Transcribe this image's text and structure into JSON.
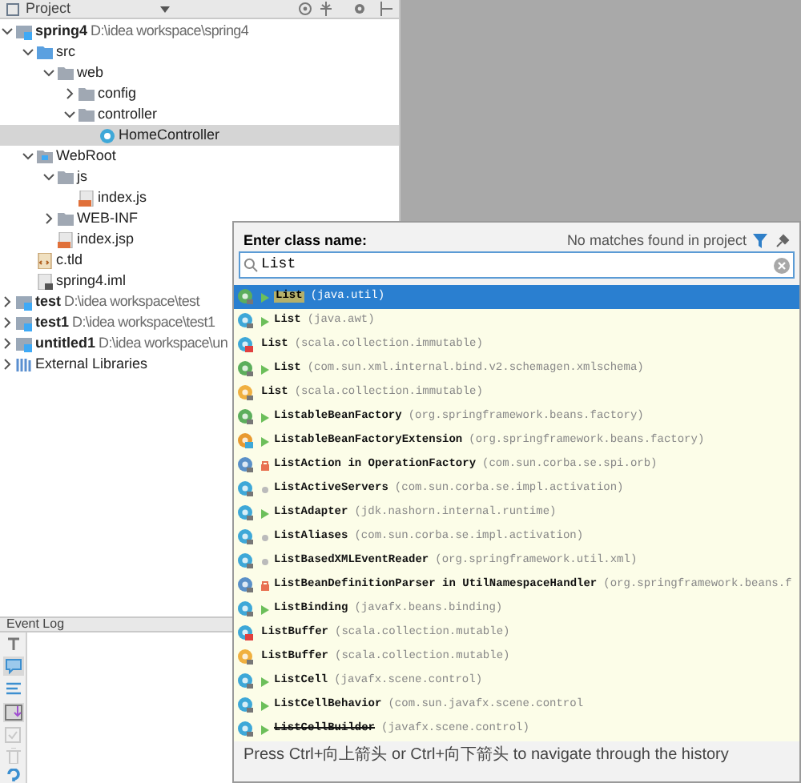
{
  "project_panel": {
    "title": "Project",
    "tree": [
      {
        "label": "spring4",
        "path": "D:\\idea workspace\\spring4",
        "kind": "module",
        "bold": true,
        "expanded": true,
        "selected": false,
        "children": [
          {
            "label": "src",
            "kind": "src",
            "expanded": true,
            "selected": false,
            "children": [
              {
                "label": "web",
                "kind": "folder",
                "expanded": true,
                "selected": false,
                "children": [
                  {
                    "label": "config",
                    "kind": "folder",
                    "expanded": false,
                    "selected": false
                  },
                  {
                    "label": "controller",
                    "kind": "folder",
                    "expanded": true,
                    "selected": false,
                    "children": [
                      {
                        "label": "HomeController",
                        "kind": "java",
                        "selected": true
                      }
                    ]
                  }
                ]
              }
            ]
          },
          {
            "label": "WebRoot",
            "kind": "webroot",
            "expanded": true,
            "selected": false,
            "children": [
              {
                "label": "js",
                "kind": "folder",
                "expanded": true,
                "selected": false,
                "children": [
                  {
                    "label": "index.js",
                    "kind": "js",
                    "selected": false
                  }
                ]
              },
              {
                "label": "WEB-INF",
                "kind": "folder",
                "expanded": false,
                "selected": false
              },
              {
                "label": "index.jsp",
                "kind": "jsp",
                "selected": false
              }
            ]
          },
          {
            "label": "c.tld",
            "kind": "tld",
            "selected": false
          },
          {
            "label": "spring4.iml",
            "kind": "iml",
            "selected": false
          }
        ]
      },
      {
        "label": "test",
        "path": "D:\\idea workspace\\test",
        "kind": "module",
        "bold": true,
        "expanded": false,
        "selected": false
      },
      {
        "label": "test1",
        "path": "D:\\idea workspace\\test1",
        "kind": "module",
        "bold": true,
        "expanded": false,
        "selected": false
      },
      {
        "label": "untitled1",
        "path": "D:\\idea workspace\\un",
        "kind": "module",
        "bold": true,
        "expanded": false,
        "selected": false
      },
      {
        "label": "External Libraries",
        "kind": "libraries",
        "bold": false,
        "expanded": false,
        "selected": false
      }
    ]
  },
  "event_log": {
    "title": "Event Log"
  },
  "class_popup": {
    "prompt": "Enter class name:",
    "status": "No matches found in project",
    "query": "List",
    "results": [
      {
        "name": "List",
        "package": "(java.util)",
        "kind": "interface",
        "access": {
          "kind": "public"
        },
        "selected": true
      },
      {
        "name": "List",
        "package": "(java.awt)",
        "kind": "class",
        "access": {
          "kind": "public"
        },
        "selected": false
      },
      {
        "name": "List",
        "package": "(scala.collection.immutable)",
        "kind": "scala",
        "selected": false
      },
      {
        "name": "List",
        "package": "(com.sun.xml.internal.bind.v2.schemagen.xmlschema)",
        "kind": "interface",
        "access": {
          "kind": "public"
        },
        "selected": false
      },
      {
        "name": "List",
        "package": "(scala.collection.immutable)",
        "kind": "object",
        "selected": false
      },
      {
        "name": "ListableBeanFactory",
        "package": "(org.springframework.beans.factory)",
        "kind": "interface",
        "access": {
          "kind": "public"
        },
        "selected": false
      },
      {
        "name": "ListableBeanFactoryExtension",
        "package": "(org.springframework.beans.factory)",
        "kind": "abstract",
        "access": {
          "kind": "public"
        },
        "selected": false
      },
      {
        "name": "ListAction in OperationFactory",
        "package": "(com.sun.corba.se.spi.orb)",
        "kind": "inner",
        "access": {
          "kind": "private"
        },
        "selected": false
      },
      {
        "name": "ListActiveServers",
        "package": "(com.sun.corba.se.impl.activation)",
        "kind": "class",
        "access": {
          "kind": "package"
        },
        "selected": false
      },
      {
        "name": "ListAdapter",
        "package": "(jdk.nashorn.internal.runtime)",
        "kind": "class",
        "access": {
          "kind": "public"
        },
        "selected": false
      },
      {
        "name": "ListAliases",
        "package": "(com.sun.corba.se.impl.activation)",
        "kind": "class",
        "access": {
          "kind": "package"
        },
        "selected": false
      },
      {
        "name": "ListBasedXMLEventReader",
        "package": "(org.springframework.util.xml)",
        "kind": "class",
        "access": {
          "kind": "package"
        },
        "selected": false
      },
      {
        "name": "ListBeanDefinitionParser in UtilNamespaceHandler",
        "package": "(org.springframework.beans.f",
        "kind": "inner",
        "access": {
          "kind": "private"
        },
        "selected": false
      },
      {
        "name": "ListBinding",
        "package": "(javafx.beans.binding)",
        "kind": "class",
        "access": {
          "kind": "public"
        },
        "selected": false
      },
      {
        "name": "ListBuffer",
        "package": "(scala.collection.mutable)",
        "kind": "scala",
        "selected": false
      },
      {
        "name": "ListBuffer",
        "package": "(scala.collection.mutable)",
        "kind": "object",
        "selected": false
      },
      {
        "name": "ListCell",
        "package": "(javafx.scene.control)",
        "kind": "class",
        "access": {
          "kind": "public"
        },
        "selected": false
      },
      {
        "name": "ListCellBehavior",
        "package": "(com.sun.javafx.scene.control",
        "kind": "class",
        "access": {
          "kind": "public"
        },
        "selected": false
      },
      {
        "name": "ListCellBuilder",
        "package": "(javafx.scene.control)",
        "kind": "class",
        "access": {
          "kind": "public"
        },
        "deprecated": true,
        "selected": false
      }
    ],
    "hint": "Press Ctrl+向上箭头 or Ctrl+向下箭头 to navigate through the history"
  }
}
